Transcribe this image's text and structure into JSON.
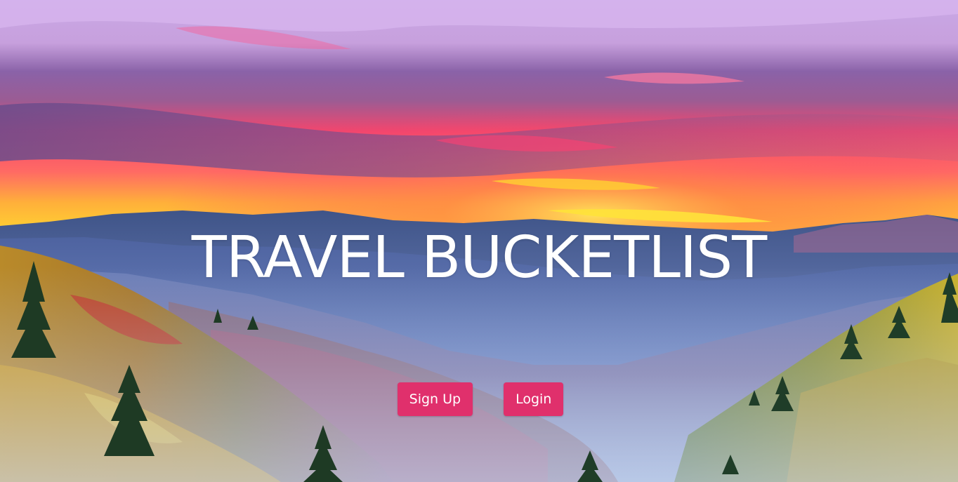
{
  "hero": {
    "title": "TRAVEL BUCKETLIST"
  },
  "buttons": {
    "signup_label": "Sign Up",
    "login_label": "Login"
  },
  "colors": {
    "button_bg": "#e0306c",
    "title_color": "#ffffff"
  }
}
